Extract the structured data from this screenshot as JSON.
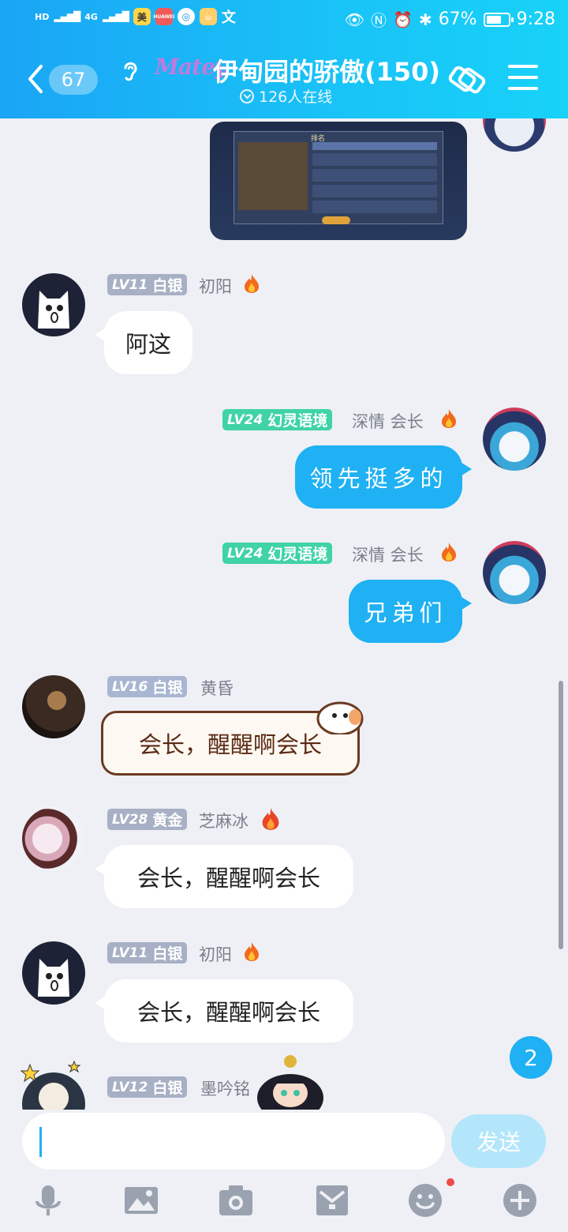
{
  "status_bar": {
    "net1": "HD",
    "net2": "4G",
    "net3": "4G",
    "app1": "美",
    "app2": "HUAWEI",
    "battery": "67%",
    "time": "9:28"
  },
  "header": {
    "unread_count": "67",
    "logo_text": "Matey",
    "group_title": "伊甸园的骄傲(150)",
    "online_text": "126人在线"
  },
  "messages": [
    {
      "type": "image",
      "side": "right"
    },
    {
      "side": "left",
      "level": "LV11",
      "tier": "白银",
      "nick": "初阳",
      "text": "阿这"
    },
    {
      "side": "right",
      "level": "LV24",
      "tier": "幻灵语境",
      "nick": "深情 会长",
      "text": "领先挺多的"
    },
    {
      "side": "right",
      "level": "LV24",
      "tier": "幻灵语境",
      "nick": "深情 会长",
      "text": "兄弟们"
    },
    {
      "side": "left",
      "level": "LV16",
      "tier": "白银",
      "nick": "黄昏",
      "text": "会长，醒醒啊会长"
    },
    {
      "side": "left",
      "level": "LV28",
      "tier": "黄金",
      "nick": "芝麻冰",
      "text": "会长，醒醒啊会长"
    },
    {
      "side": "left",
      "level": "LV11",
      "tier": "白银",
      "nick": "初阳",
      "text": "会长，醒醒啊会长"
    },
    {
      "side": "left",
      "level": "LV12",
      "tier": "白银",
      "nick": "墨吟铭"
    }
  ],
  "new_message_count": "2",
  "input": {
    "placeholder": "",
    "send_label": "发送"
  },
  "colors": {
    "accent": "#1fb1f3",
    "header_start": "#1aa5f5",
    "header_end": "#18d2f8",
    "badge_silver": "#a7b0c4",
    "badge_spirit": "#3fd3a5"
  },
  "icons": [
    "back-icon",
    "ear-icon",
    "online-chevron-icon",
    "share-icon",
    "menu-icon",
    "flame-icon",
    "mic-icon",
    "image-icon",
    "camera-icon",
    "gift-icon",
    "emoji-icon",
    "plus-icon"
  ]
}
